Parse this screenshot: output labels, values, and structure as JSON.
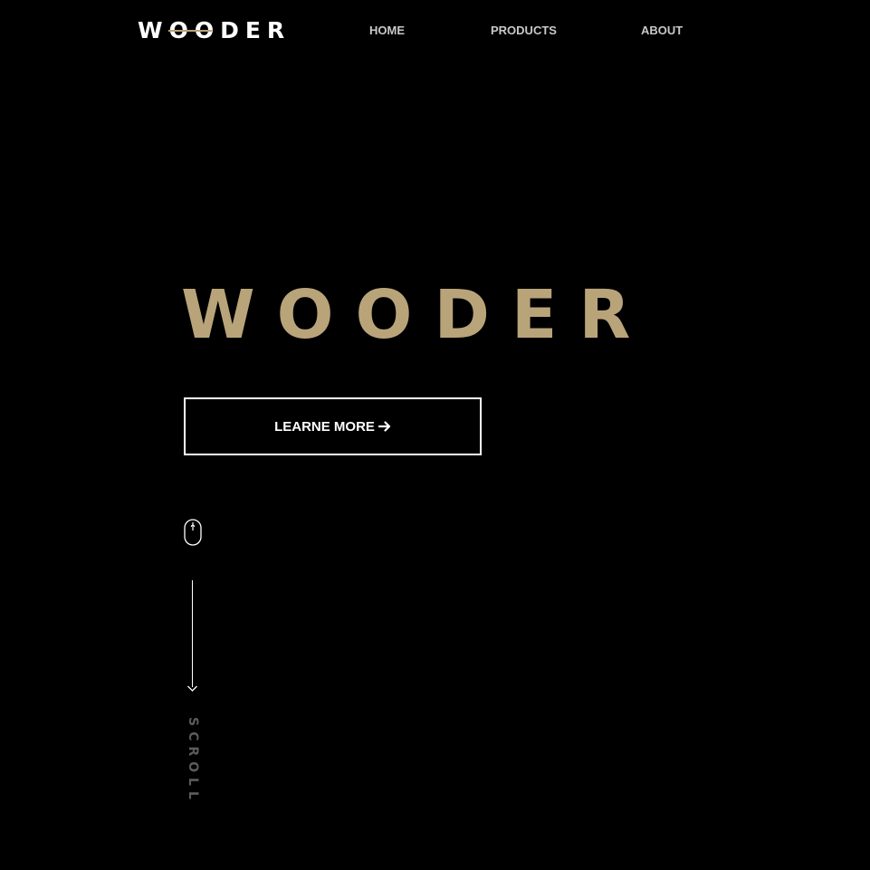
{
  "header": {
    "logo_text": "WOODER"
  },
  "nav": {
    "home": "HOME",
    "products": "PRODUCTS",
    "about": "ABOUT"
  },
  "hero": {
    "title": "WOODER",
    "cta_label": "LEARNE MORE",
    "cta_icon": "arrow-right-icon"
  },
  "scroll_indicator": {
    "mouse_icon": "mouse-icon",
    "arrow_icon": "arrow-down-icon",
    "label": "SCROLL"
  },
  "colors": {
    "background": "#000000",
    "accent": "#b9a47a",
    "text": "#ffffff",
    "nav_text": "#c9c9c9",
    "muted": "#5c5c5c"
  }
}
